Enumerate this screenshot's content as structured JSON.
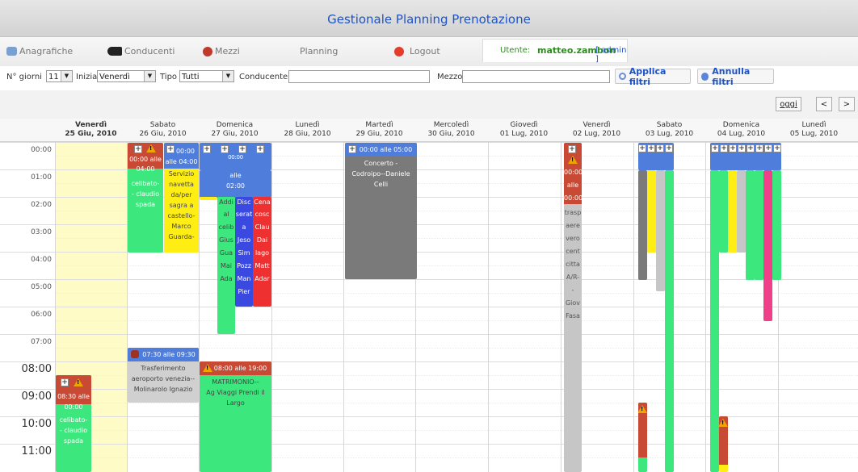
{
  "app": {
    "title": "Gestionale Planning Prenotazione",
    "menu": [
      "Anagrafiche",
      "Conducenti",
      "Mezzi",
      "Planning",
      "Logout"
    ],
    "user_label": "Utente:",
    "username": "matteo.zambon",
    "role": "[ admin ]"
  },
  "filters": {
    "ngiorni_label": "N° giorni",
    "ngiorni_value": "11",
    "inizia_label": "Inizia",
    "inizia_value": "Venerdì",
    "tipo_label": "Tipo",
    "tipo_value": "Tutti",
    "conducente_label": "Conducente",
    "conducente_value": "",
    "mezzo_label": "Mezzo",
    "mezzo_value": "",
    "apply_label": "Applica filtri",
    "cancel_label": "Annulla filtri"
  },
  "nav": {
    "today": "oggi",
    "prev": "<",
    "next": ">"
  },
  "days": [
    {
      "name": "Venerdì",
      "date": "25 Giu, 2010",
      "bold": true
    },
    {
      "name": "Sabato",
      "date": "26 Giu, 2010"
    },
    {
      "name": "Domenica",
      "date": "27 Giu, 2010"
    },
    {
      "name": "Lunedì",
      "date": "28 Giu, 2010"
    },
    {
      "name": "Martedì",
      "date": "29 Giu, 2010"
    },
    {
      "name": "Mercoledì",
      "date": "30 Giu, 2010"
    },
    {
      "name": "Giovedì",
      "date": "01 Lug, 2010"
    },
    {
      "name": "Venerdì",
      "date": "02 Lug, 2010"
    },
    {
      "name": "Sabato",
      "date": "03 Lug, 2010"
    },
    {
      "name": "Domenica",
      "date": "04 Lug, 2010"
    },
    {
      "name": "Lunedì",
      "date": "05 Lug, 2010"
    }
  ],
  "hours": [
    "00:00",
    "01:00",
    "02:00",
    "03:00",
    "04:00",
    "05:00",
    "06:00",
    "07:00",
    "08:00",
    "09:00",
    "10:00",
    "11:00"
  ],
  "colors": {
    "red": "#c84a35",
    "green": "#3ce87d",
    "yellow": "#ffee14",
    "blue": "#4e7ddb",
    "darkblue": "#3a4ae0",
    "gray": "#7a7a7a",
    "lightgray": "#c6c6c6",
    "pink": "#f0408a",
    "today": "#fffbc6"
  },
  "events": {
    "sat_celibato": [
      "00:00 alle",
      "04:00",
      "celibato-",
      "- claudio",
      "spada"
    ],
    "sat_servizio": [
      "00:00",
      "alle 04:00",
      "Servizio",
      "navetta",
      "da/per",
      "sagra a",
      "castello-",
      "Marco",
      "Guarda-"
    ],
    "sun_cols": [
      "00:00",
      "alle",
      "02:00",
      "Cena",
      "Addi",
      "al",
      "celib",
      "Gius",
      "Gua",
      "Mai",
      "Ada"
    ],
    "sun_disco": [
      "Disc",
      "serat",
      "a",
      "Jeso",
      "Sim",
      "Pozz",
      "Man",
      "Pier"
    ],
    "sun_cena": [
      "Cena",
      "cosc",
      "Clau",
      "Dai",
      "lago",
      "Matt",
      "Adar"
    ],
    "tue_concerto": [
      "00:00 alle 05:00",
      "Concerto -",
      "Codroipo--Daniele",
      "Celli"
    ],
    "sat_trasferimento": [
      "07:30 alle 09:30",
      "Trasferimento",
      "aeroporto venezia--",
      "Molinarolo Ignazio"
    ],
    "sun_matrimonio": [
      "08:00 alle 19:00",
      "MATRIMONIO--",
      "Ag Viaggi Prendi il",
      "Largo"
    ],
    "fri_celibato2": [
      "08:30 alle",
      "00:00",
      "celibato-",
      "- claudio",
      "spada"
    ],
    "fri2_col": [
      "00:00",
      "alle",
      "00:00",
      "trasp",
      "aere",
      "vero",
      "cent",
      "citta",
      "A/R-",
      "-",
      "Giov",
      "Fasa"
    ]
  }
}
